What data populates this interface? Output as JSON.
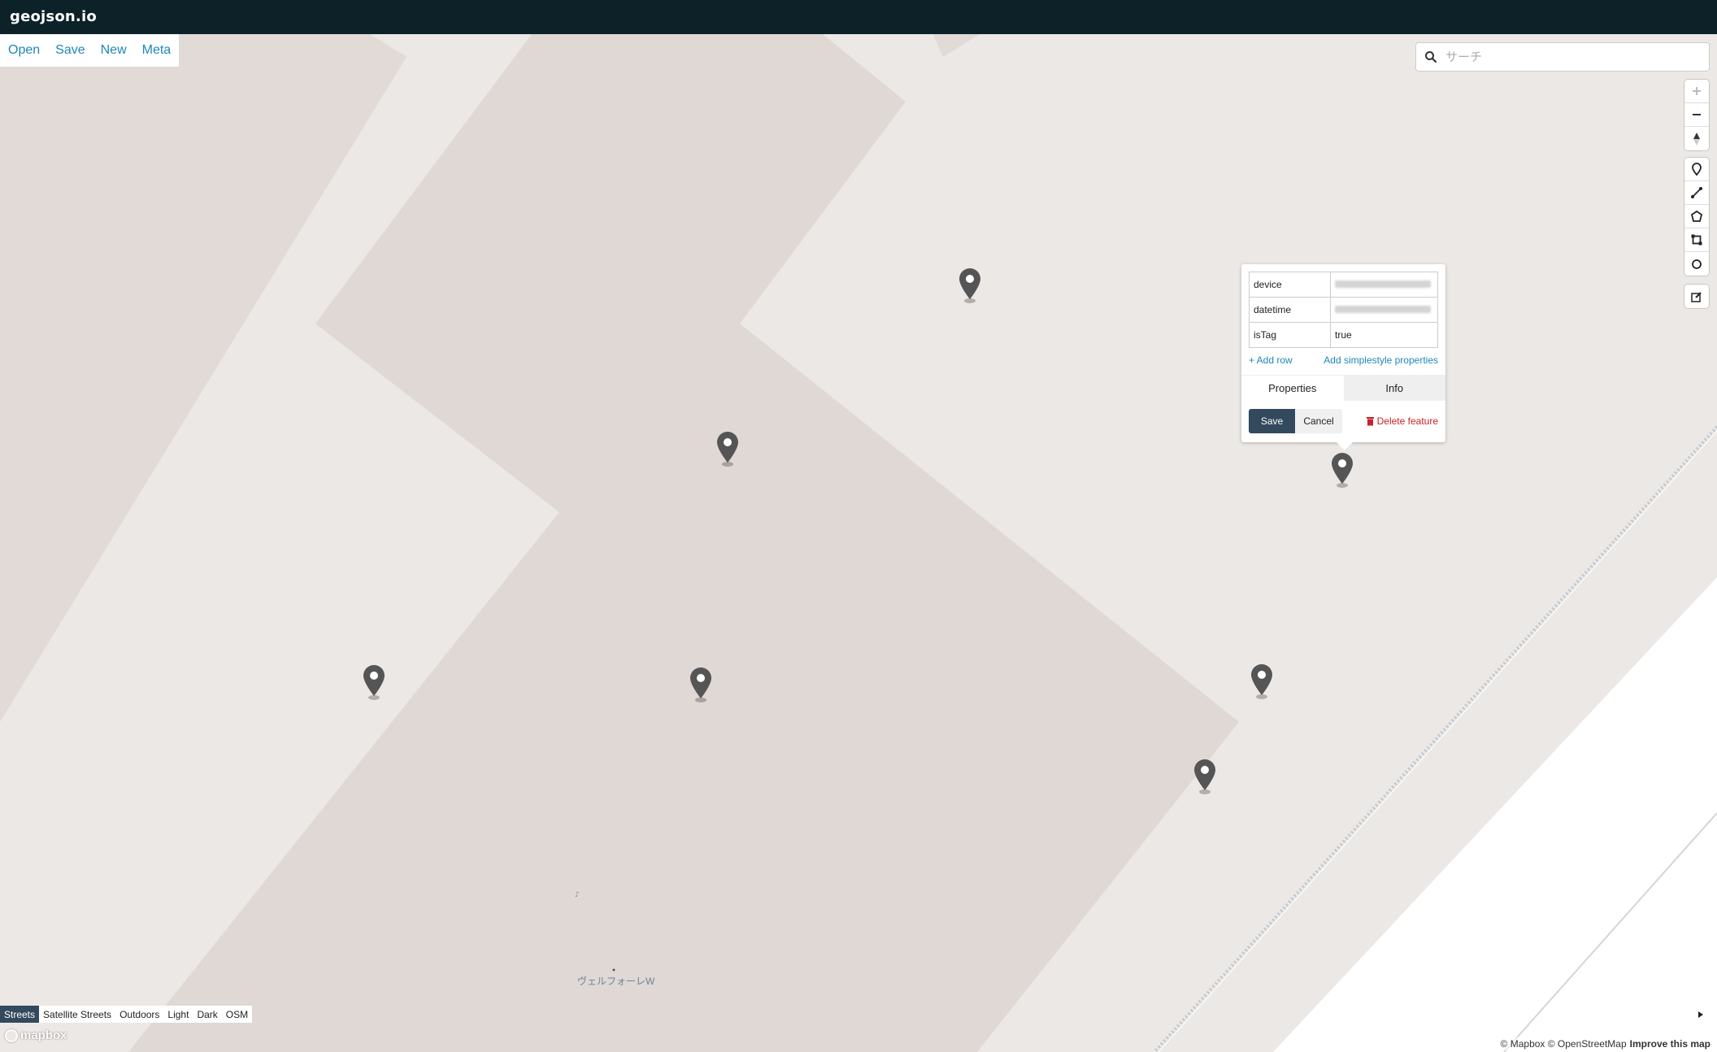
{
  "app": {
    "title": "geojson.io"
  },
  "menu": {
    "items": [
      "Open",
      "Save",
      "New",
      "Meta"
    ]
  },
  "search": {
    "placeholder": "サーチ"
  },
  "popup": {
    "rows": [
      {
        "key": "device",
        "value": ""
      },
      {
        "key": "datetime",
        "value": ""
      },
      {
        "key": "isTag",
        "value": "true"
      }
    ],
    "add_row": "+ Add row",
    "add_simplestyle": "Add simplestyle properties",
    "tabs": [
      "Properties",
      "Info"
    ],
    "active_tab": "Properties",
    "save_label": "Save",
    "cancel_label": "Cancel",
    "delete_label": "Delete feature"
  },
  "layers": {
    "items": [
      "Streets",
      "Satellite Streets",
      "Outdoors",
      "Light",
      "Dark",
      "OSM"
    ],
    "active": "Streets"
  },
  "map": {
    "label": "ヴェルフォーレW",
    "logo": "mapbox",
    "attribution": "© Mapbox © OpenStreetMap",
    "improve": "Improve this map"
  },
  "colors": {
    "topbar": "#0c2128",
    "link": "#1d87b9",
    "active_button": "#33495d",
    "delete": "#c9202a",
    "pin": "#555555",
    "map_background": "#ece8e5",
    "building": "#dfd8d5"
  },
  "icons": {
    "controls": [
      "zoom-in-icon",
      "zoom-out-icon",
      "compass-icon"
    ],
    "draw_tools": [
      "marker-icon",
      "line-icon",
      "polygon-icon",
      "rectangle-icon",
      "circle-icon"
    ],
    "edit": "edit-icon",
    "trash": "trash-icon",
    "search": "search-icon"
  }
}
